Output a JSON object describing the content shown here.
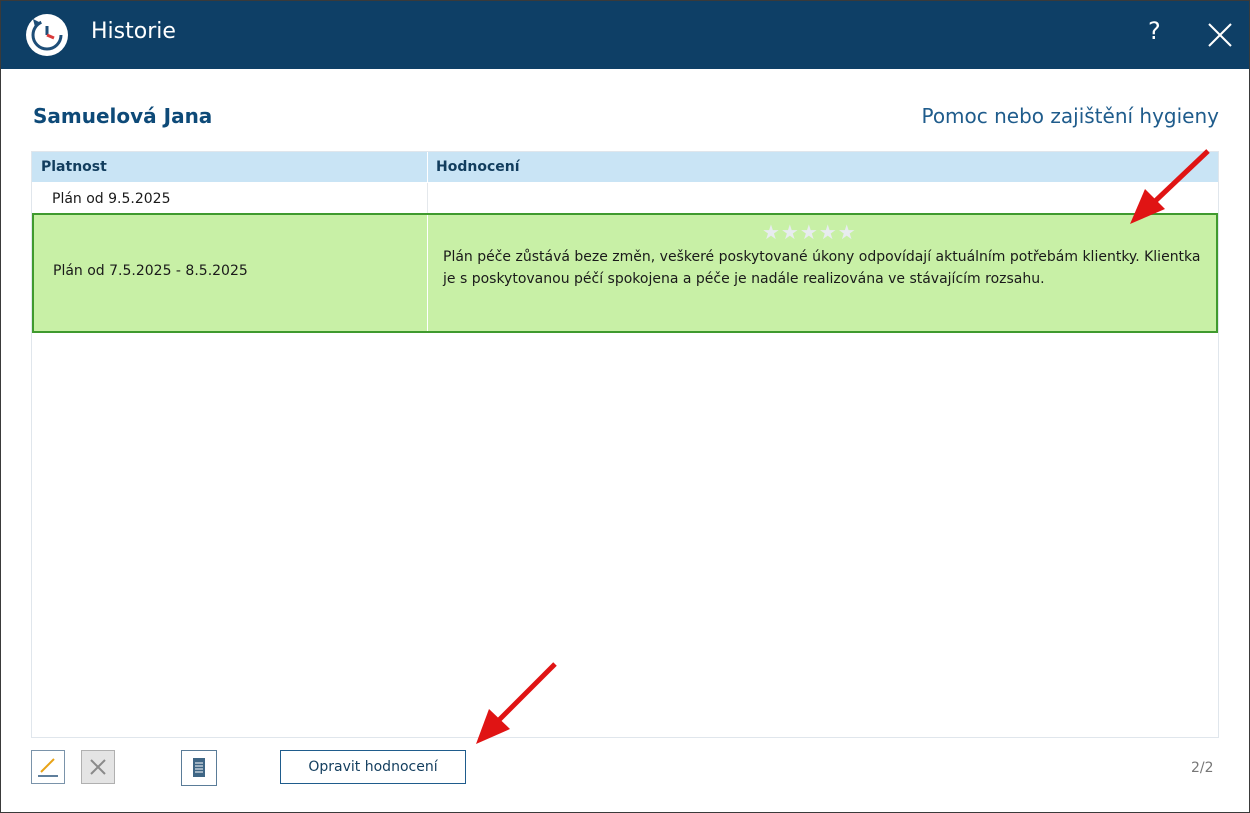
{
  "window": {
    "title": "Historie",
    "help": "?"
  },
  "client": {
    "name": "Samuelová Jana",
    "service": "Pomoc nebo zajištění hygieny"
  },
  "table": {
    "columns": [
      "Platnost",
      "Hodnocení"
    ],
    "rows": [
      {
        "validity": "Plán od 9.5.2025",
        "evaluation": "",
        "selected": false
      },
      {
        "validity": "Plán od 7.5.2025 - 8.5.2025",
        "rating": 0,
        "rating_max": 5,
        "stars": "★★★★★",
        "evaluation": "Plán péče zůstává beze změn, veškeré poskytované úkony odpovídají aktuálním potřebám klientky. Klientka je s poskytovanou péčí spokojena a péče je nadále realizována ve stávajícím rozsahu.",
        "selected": true
      }
    ]
  },
  "footer": {
    "fix_button": "Opravit hodnocení",
    "page": "2/2"
  },
  "colors": {
    "titlebar": "#0e3f66",
    "header": "#c9e4f5",
    "selected_row": "#c8f0a6",
    "selected_border": "#3f9a2e",
    "annotation_arrow": "#e01414"
  },
  "icons": [
    "history-clock-icon",
    "help-icon",
    "close-icon",
    "pencil-icon",
    "x-icon",
    "document-icon",
    "star-icon"
  ]
}
